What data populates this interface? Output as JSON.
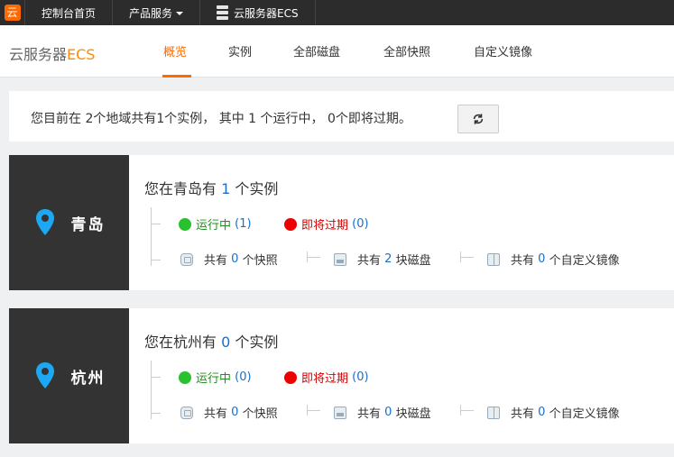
{
  "topbar": {
    "logo_char": "云",
    "items": [
      {
        "label": "控制台首页"
      },
      {
        "label": "产品服务"
      },
      {
        "label": "云服务器ECS"
      }
    ]
  },
  "subnav": {
    "brand_prefix": "云服务器",
    "brand_suffix": "ECS",
    "tabs": [
      {
        "label": "概览",
        "active": true
      },
      {
        "label": "实例"
      },
      {
        "label": "全部磁盘"
      },
      {
        "label": "全部快照"
      },
      {
        "label": "自定义镜像"
      }
    ]
  },
  "summary": {
    "text": "您目前在 2个地域共有1个实例， 其中 1 个运行中， 0个即将过期。"
  },
  "regions": [
    {
      "name": "青岛",
      "title_prefix": "您在青岛有",
      "instance_count": "1",
      "title_suffix": "个实例",
      "running_label": "运行中",
      "running_count": "(1)",
      "expiring_label": "即将过期",
      "expiring_count": "(0)",
      "snap_prefix": "共有",
      "snap_count": "0",
      "snap_suffix": "个快照",
      "disk_prefix": "共有",
      "disk_count": "2",
      "disk_suffix": "块磁盘",
      "image_prefix": "共有",
      "image_count": "0",
      "image_suffix": "个自定义镜像"
    },
    {
      "name": "杭州",
      "title_prefix": "您在杭州有",
      "instance_count": "0",
      "title_suffix": "个实例",
      "running_label": "运行中",
      "running_count": "(0)",
      "expiring_label": "即将过期",
      "expiring_count": "(0)",
      "snap_prefix": "共有",
      "snap_count": "0",
      "snap_suffix": "个快照",
      "disk_prefix": "共有",
      "disk_count": "0",
      "disk_suffix": "块磁盘",
      "image_prefix": "共有",
      "image_count": "0",
      "image_suffix": "个自定义镜像"
    }
  ],
  "colors": {
    "accent": "#ff6a00",
    "running": "#2ac12e",
    "expiring": "#ee0000",
    "link_blue": "#1a6fc9"
  }
}
